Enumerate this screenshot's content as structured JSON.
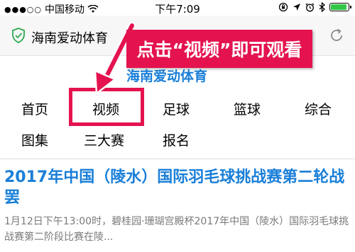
{
  "status_bar": {
    "carrier": "中国移动",
    "time": "下午7:09",
    "battery_level": 0.9
  },
  "browser": {
    "site_name": "海南爱动体育"
  },
  "annotation": {
    "text": "点击“视频”即可观看"
  },
  "page": {
    "header": "海南爱动体育"
  },
  "nav": {
    "items": [
      "首页",
      "视频",
      "足球",
      "篮球",
      "综合",
      "图集",
      "三大赛",
      "报名"
    ]
  },
  "article": {
    "title": "2017年中国（陵水）国际羽毛球挑战赛第二轮战罢",
    "summary": "1月12日下午13:00时，碧桂园·珊瑚宫殿杯2017年中国（陵水）国际羽毛球挑战赛第二阶段比赛在陵..."
  },
  "colors": {
    "accent_red": "#e4134f",
    "link_blue": "#1a7fd8",
    "shield_green": "#2fa84f"
  },
  "icons": [
    "wifi-icon",
    "lock-rotation-icon",
    "location-arrow-icon",
    "alarm-icon",
    "bluetooth-icon",
    "battery-icon",
    "shield-icon",
    "refresh-icon",
    "arrow-pointer"
  ]
}
